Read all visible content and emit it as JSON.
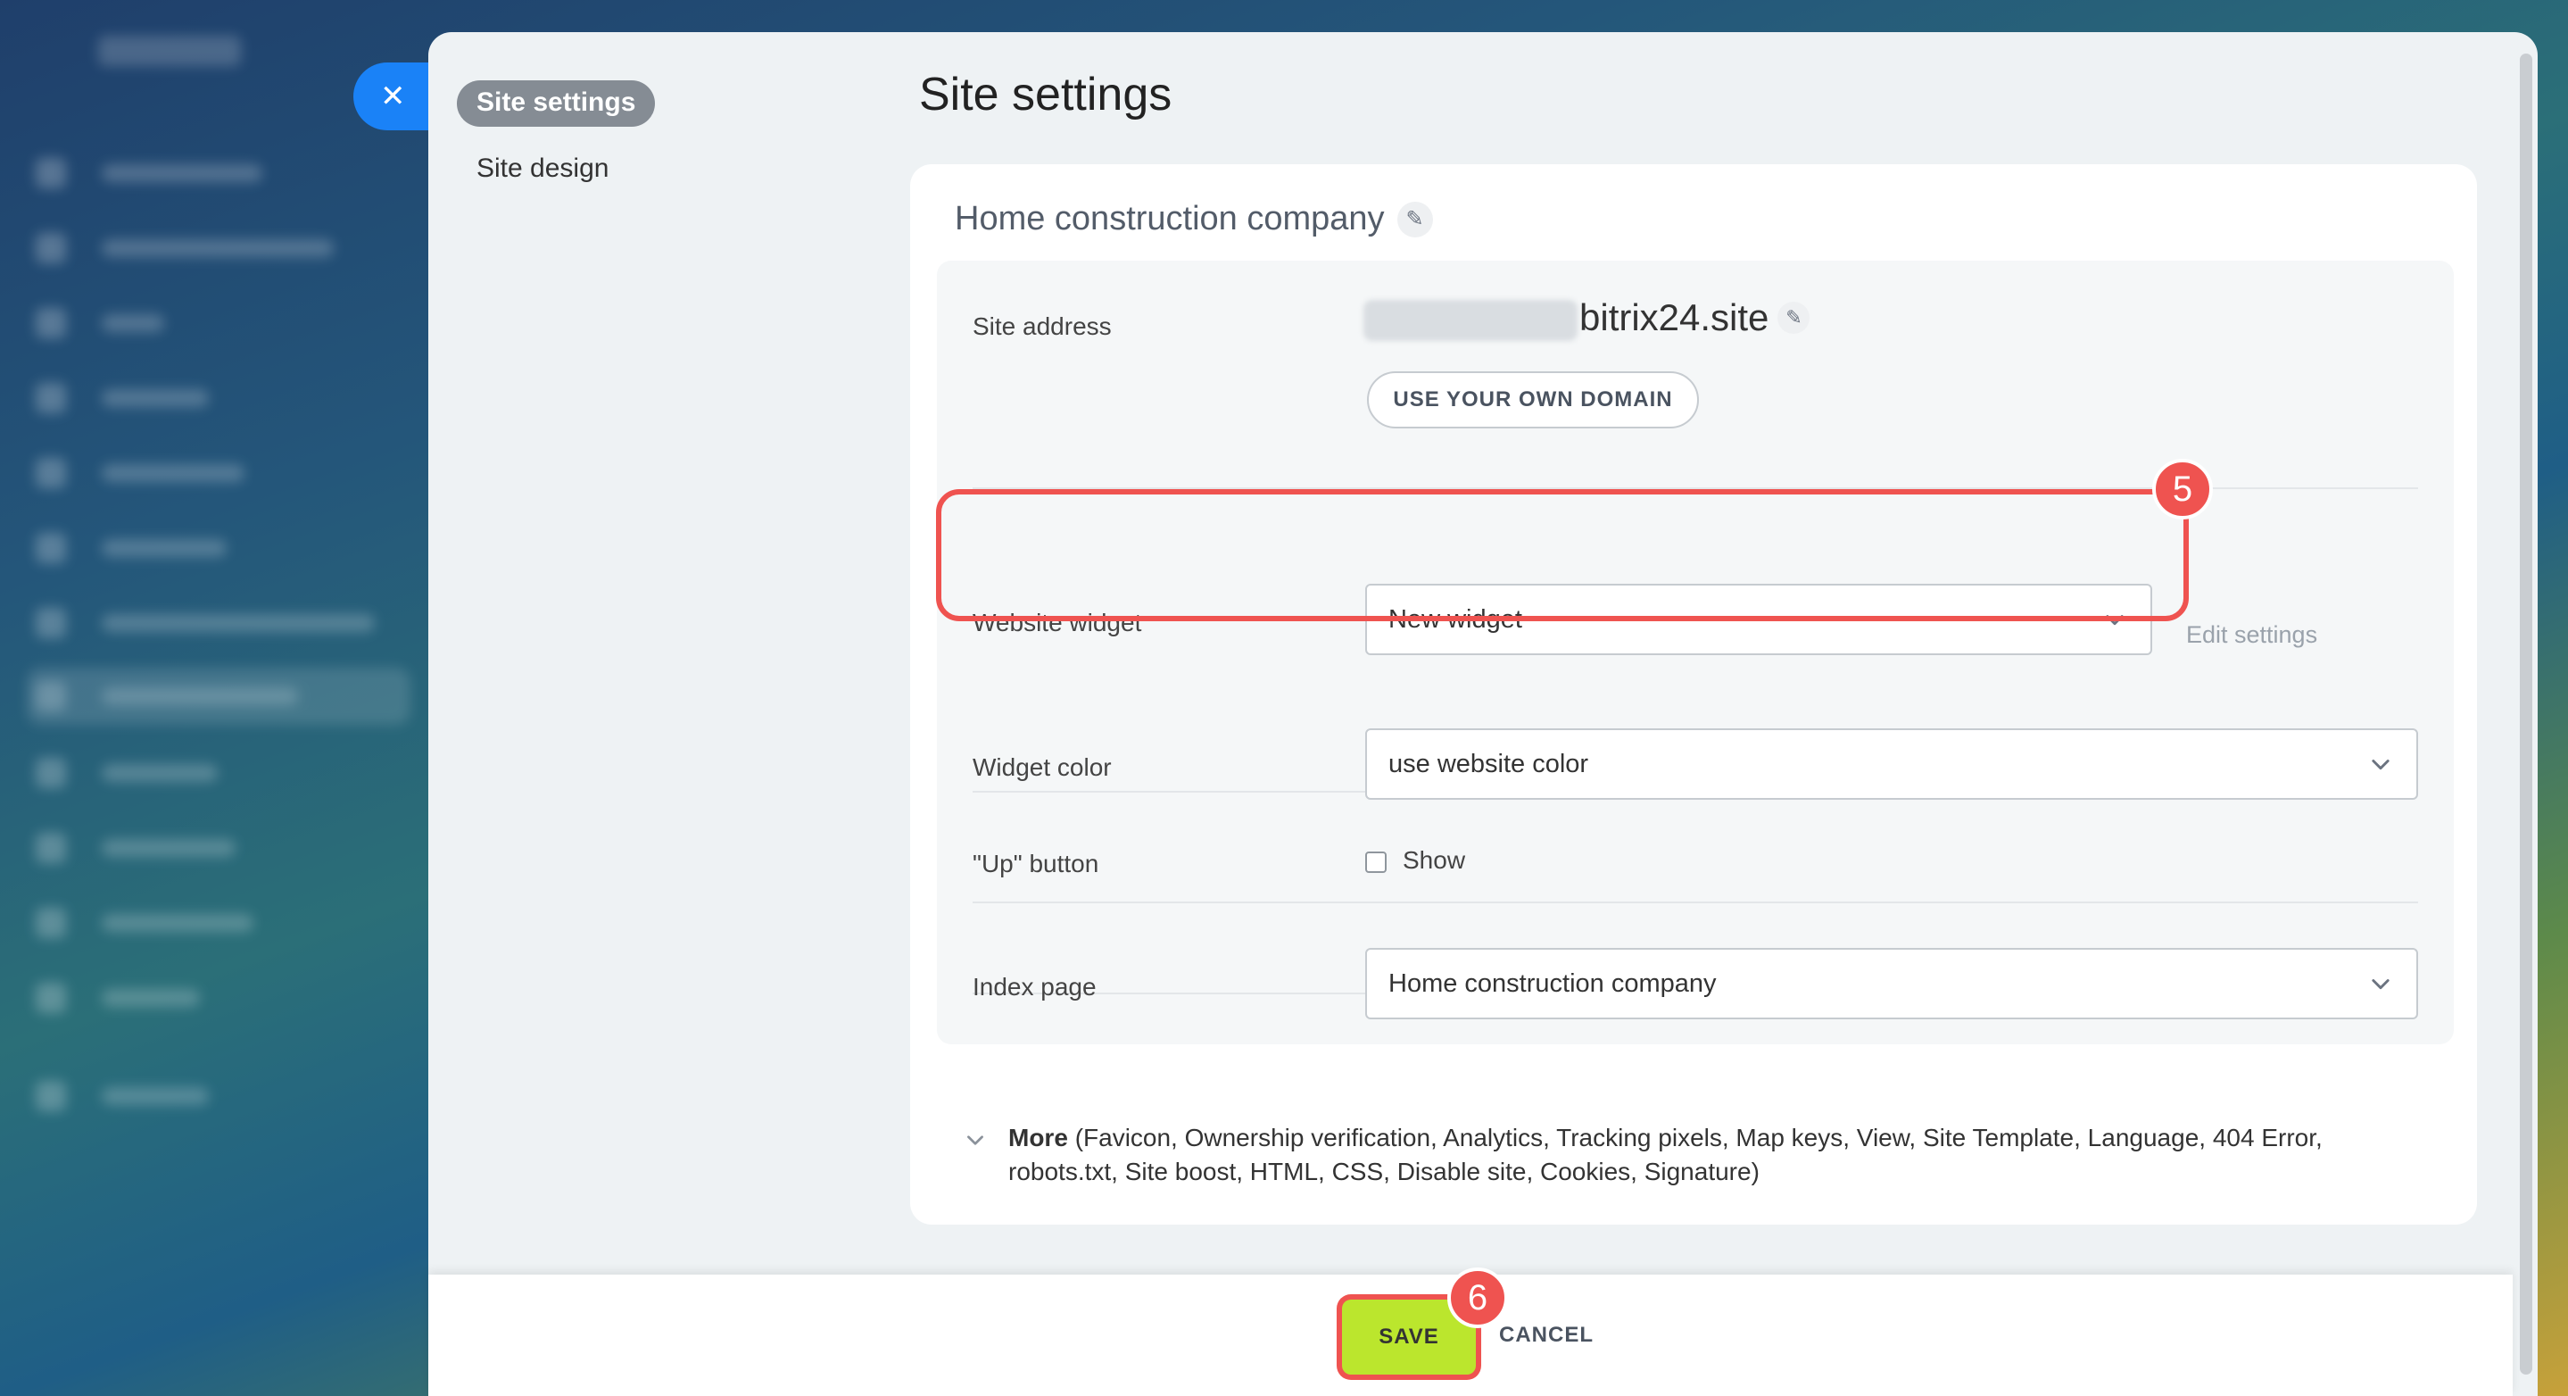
{
  "slider": {
    "close_icon": "close-icon",
    "nav": [
      {
        "label": "Site settings",
        "active": true
      },
      {
        "label": "Site design",
        "active": false
      }
    ],
    "title": "Site settings"
  },
  "card": {
    "site_name": "Home construction company",
    "rows": {
      "site_address": {
        "label": "Site address",
        "domain": "bitrix24.site",
        "own_domain_button": "USE YOUR OWN DOMAIN"
      },
      "website_widget": {
        "label": "Website widget",
        "value": "New widget",
        "edit_link": "Edit settings"
      },
      "widget_color": {
        "label": "Widget color",
        "value": "use website color"
      },
      "up_button": {
        "label": "\"Up\" button",
        "checkbox_label": "Show",
        "checked": false
      },
      "index_page": {
        "label": "Index page",
        "value": "Home construction company"
      }
    },
    "more": {
      "label": "More",
      "items_text": "(Favicon,  Ownership verification,  Analytics,  Tracking pixels,  Map keys,  View,  Site Template,  Language,  404 Error,  robots.txt,  Site boost,  HTML,  CSS,  Disable site,  Cookies,  Signature)"
    }
  },
  "annotations": {
    "step_widget": "5",
    "step_save": "6",
    "highlight_color": "#ef5350"
  },
  "footer": {
    "save": "SAVE",
    "cancel": "CANCEL",
    "save_color": "#bbe62d"
  },
  "colors": {
    "close_tab": "#1a82f7",
    "panel_bg": "#eef2f4"
  }
}
